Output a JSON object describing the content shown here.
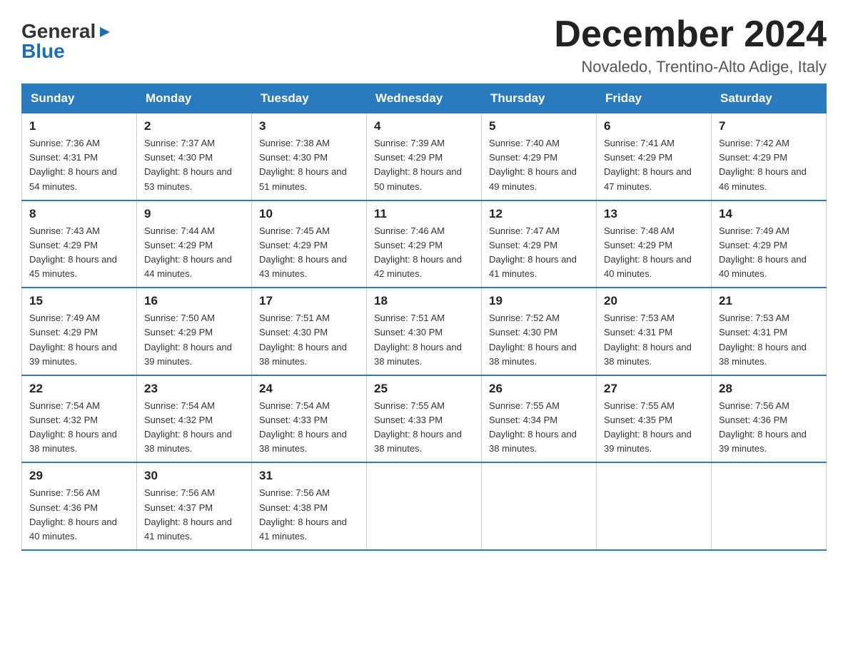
{
  "logo": {
    "general": "General",
    "triangle": "▶",
    "blue": "Blue"
  },
  "title": "December 2024",
  "location": "Novaledo, Trentino-Alto Adige, Italy",
  "headers": [
    "Sunday",
    "Monday",
    "Tuesday",
    "Wednesday",
    "Thursday",
    "Friday",
    "Saturday"
  ],
  "weeks": [
    [
      {
        "day": "1",
        "sunrise": "7:36 AM",
        "sunset": "4:31 PM",
        "daylight": "8 hours and 54 minutes."
      },
      {
        "day": "2",
        "sunrise": "7:37 AM",
        "sunset": "4:30 PM",
        "daylight": "8 hours and 53 minutes."
      },
      {
        "day": "3",
        "sunrise": "7:38 AM",
        "sunset": "4:30 PM",
        "daylight": "8 hours and 51 minutes."
      },
      {
        "day": "4",
        "sunrise": "7:39 AM",
        "sunset": "4:29 PM",
        "daylight": "8 hours and 50 minutes."
      },
      {
        "day": "5",
        "sunrise": "7:40 AM",
        "sunset": "4:29 PM",
        "daylight": "8 hours and 49 minutes."
      },
      {
        "day": "6",
        "sunrise": "7:41 AM",
        "sunset": "4:29 PM",
        "daylight": "8 hours and 47 minutes."
      },
      {
        "day": "7",
        "sunrise": "7:42 AM",
        "sunset": "4:29 PM",
        "daylight": "8 hours and 46 minutes."
      }
    ],
    [
      {
        "day": "8",
        "sunrise": "7:43 AM",
        "sunset": "4:29 PM",
        "daylight": "8 hours and 45 minutes."
      },
      {
        "day": "9",
        "sunrise": "7:44 AM",
        "sunset": "4:29 PM",
        "daylight": "8 hours and 44 minutes."
      },
      {
        "day": "10",
        "sunrise": "7:45 AM",
        "sunset": "4:29 PM",
        "daylight": "8 hours and 43 minutes."
      },
      {
        "day": "11",
        "sunrise": "7:46 AM",
        "sunset": "4:29 PM",
        "daylight": "8 hours and 42 minutes."
      },
      {
        "day": "12",
        "sunrise": "7:47 AM",
        "sunset": "4:29 PM",
        "daylight": "8 hours and 41 minutes."
      },
      {
        "day": "13",
        "sunrise": "7:48 AM",
        "sunset": "4:29 PM",
        "daylight": "8 hours and 40 minutes."
      },
      {
        "day": "14",
        "sunrise": "7:49 AM",
        "sunset": "4:29 PM",
        "daylight": "8 hours and 40 minutes."
      }
    ],
    [
      {
        "day": "15",
        "sunrise": "7:49 AM",
        "sunset": "4:29 PM",
        "daylight": "8 hours and 39 minutes."
      },
      {
        "day": "16",
        "sunrise": "7:50 AM",
        "sunset": "4:29 PM",
        "daylight": "8 hours and 39 minutes."
      },
      {
        "day": "17",
        "sunrise": "7:51 AM",
        "sunset": "4:30 PM",
        "daylight": "8 hours and 38 minutes."
      },
      {
        "day": "18",
        "sunrise": "7:51 AM",
        "sunset": "4:30 PM",
        "daylight": "8 hours and 38 minutes."
      },
      {
        "day": "19",
        "sunrise": "7:52 AM",
        "sunset": "4:30 PM",
        "daylight": "8 hours and 38 minutes."
      },
      {
        "day": "20",
        "sunrise": "7:53 AM",
        "sunset": "4:31 PM",
        "daylight": "8 hours and 38 minutes."
      },
      {
        "day": "21",
        "sunrise": "7:53 AM",
        "sunset": "4:31 PM",
        "daylight": "8 hours and 38 minutes."
      }
    ],
    [
      {
        "day": "22",
        "sunrise": "7:54 AM",
        "sunset": "4:32 PM",
        "daylight": "8 hours and 38 minutes."
      },
      {
        "day": "23",
        "sunrise": "7:54 AM",
        "sunset": "4:32 PM",
        "daylight": "8 hours and 38 minutes."
      },
      {
        "day": "24",
        "sunrise": "7:54 AM",
        "sunset": "4:33 PM",
        "daylight": "8 hours and 38 minutes."
      },
      {
        "day": "25",
        "sunrise": "7:55 AM",
        "sunset": "4:33 PM",
        "daylight": "8 hours and 38 minutes."
      },
      {
        "day": "26",
        "sunrise": "7:55 AM",
        "sunset": "4:34 PM",
        "daylight": "8 hours and 38 minutes."
      },
      {
        "day": "27",
        "sunrise": "7:55 AM",
        "sunset": "4:35 PM",
        "daylight": "8 hours and 39 minutes."
      },
      {
        "day": "28",
        "sunrise": "7:56 AM",
        "sunset": "4:36 PM",
        "daylight": "8 hours and 39 minutes."
      }
    ],
    [
      {
        "day": "29",
        "sunrise": "7:56 AM",
        "sunset": "4:36 PM",
        "daylight": "8 hours and 40 minutes."
      },
      {
        "day": "30",
        "sunrise": "7:56 AM",
        "sunset": "4:37 PM",
        "daylight": "8 hours and 41 minutes."
      },
      {
        "day": "31",
        "sunrise": "7:56 AM",
        "sunset": "4:38 PM",
        "daylight": "8 hours and 41 minutes."
      },
      null,
      null,
      null,
      null
    ]
  ]
}
